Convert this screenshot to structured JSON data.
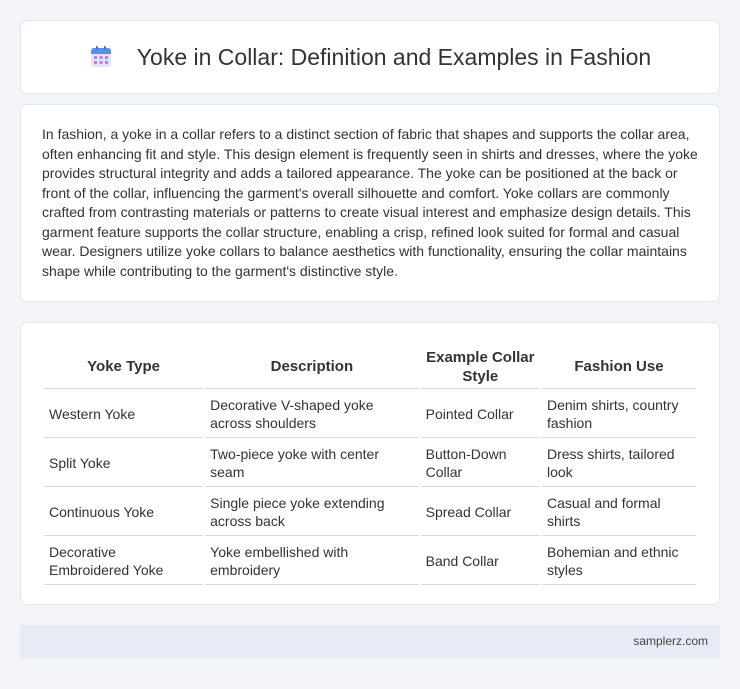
{
  "header": {
    "icon": "calendar-icon",
    "title": "Yoke in Collar: Definition and Examples in Fashion"
  },
  "description": "In fashion, a yoke in a collar refers to a distinct section of fabric that shapes and supports the collar area, often enhancing fit and style. This design element is frequently seen in shirts and dresses, where the yoke provides structural integrity and adds a tailored appearance. The yoke can be positioned at the back or front of the collar, influencing the garment's overall silhouette and comfort. Yoke collars are commonly crafted from contrasting materials or patterns to create visual interest and emphasize design details. This garment feature supports the collar structure, enabling a crisp, refined look suited for formal and casual wear. Designers utilize yoke collars to balance aesthetics with functionality, ensuring the collar maintains shape while contributing to the garment's distinctive style.",
  "table": {
    "headers": [
      "Yoke Type",
      "Description",
      "Example Collar Style",
      "Fashion Use"
    ],
    "rows": [
      [
        "Western Yoke",
        "Decorative V-shaped yoke across shoulders",
        "Pointed Collar",
        "Denim shirts, country fashion"
      ],
      [
        "Split Yoke",
        "Two-piece yoke with center seam",
        "Button-Down Collar",
        "Dress shirts, tailored look"
      ],
      [
        "Continuous Yoke",
        "Single piece yoke extending across back",
        "Spread Collar",
        "Casual and formal shirts"
      ],
      [
        "Decorative Embroidered Yoke",
        "Yoke embellished with embroidery",
        "Band Collar",
        "Bohemian and ethnic styles"
      ]
    ]
  },
  "footer": {
    "text": "samplerz.com"
  },
  "colors": {
    "background": "#f2f4f7",
    "footer_bg": "#e6ebf5",
    "icon_blue": "#5b8def",
    "icon_purple": "#a98ae0"
  }
}
